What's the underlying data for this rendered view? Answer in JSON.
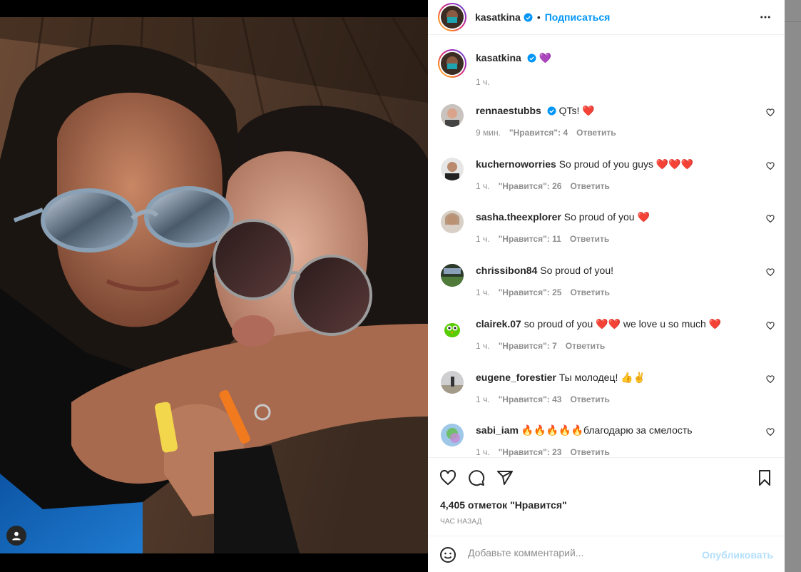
{
  "post": {
    "author": "kasatkina",
    "follow_label": "Подписаться",
    "caption_emoji": "💜",
    "caption_time": "1 ч.",
    "likes_text": "4,405 отметок \"Нравится\"",
    "posted_ago": "ЧАС НАЗАД"
  },
  "comments": [
    {
      "user": "rennaestubbs",
      "verified": true,
      "text": "QTs! ❤️",
      "time": "9 мин.",
      "likes": "\"Нравится\": 4",
      "reply": "Ответить"
    },
    {
      "user": "kuchernoworries",
      "verified": false,
      "text": "So proud of you guys ❤️❤️❤️",
      "time": "1 ч.",
      "likes": "\"Нравится\": 26",
      "reply": "Ответить"
    },
    {
      "user": "sasha.theexplorer",
      "verified": false,
      "text": "So proud of you ❤️",
      "time": "1 ч.",
      "likes": "\"Нравится\": 11",
      "reply": "Ответить"
    },
    {
      "user": "chrissibon84",
      "verified": false,
      "text": "So proud of you!",
      "time": "1 ч.",
      "likes": "\"Нравится\": 25",
      "reply": "Ответить"
    },
    {
      "user": "clairek.07",
      "verified": false,
      "text": "so proud of you ❤️❤️ we love u so much ❤️",
      "time": "1 ч.",
      "likes": "\"Нравится\": 7",
      "reply": "Ответить"
    },
    {
      "user": "eugene_forestier",
      "verified": false,
      "text": "Ты молодец! 👍✌️",
      "time": "1 ч.",
      "likes": "\"Нравится\": 43",
      "reply": "Ответить"
    },
    {
      "user": "sabi_iam",
      "verified": false,
      "text": "🔥🔥🔥🔥🔥благодарю за смелость",
      "time": "1 ч.",
      "likes": "\"Нравится\": 23",
      "reply": "Ответить"
    }
  ],
  "composer": {
    "placeholder": "Добавьте комментарий...",
    "post_label": "Опубликовать"
  },
  "colors": {
    "accent": "#0095f6",
    "verified": "#0095f6",
    "heart_red": "#ed4956",
    "muted": "#8e8e8e"
  },
  "icons": [
    "more-icon",
    "verified-icon",
    "heart-icon",
    "comment-icon",
    "share-icon",
    "bookmark-icon",
    "emoji-icon",
    "user-tag-icon"
  ]
}
